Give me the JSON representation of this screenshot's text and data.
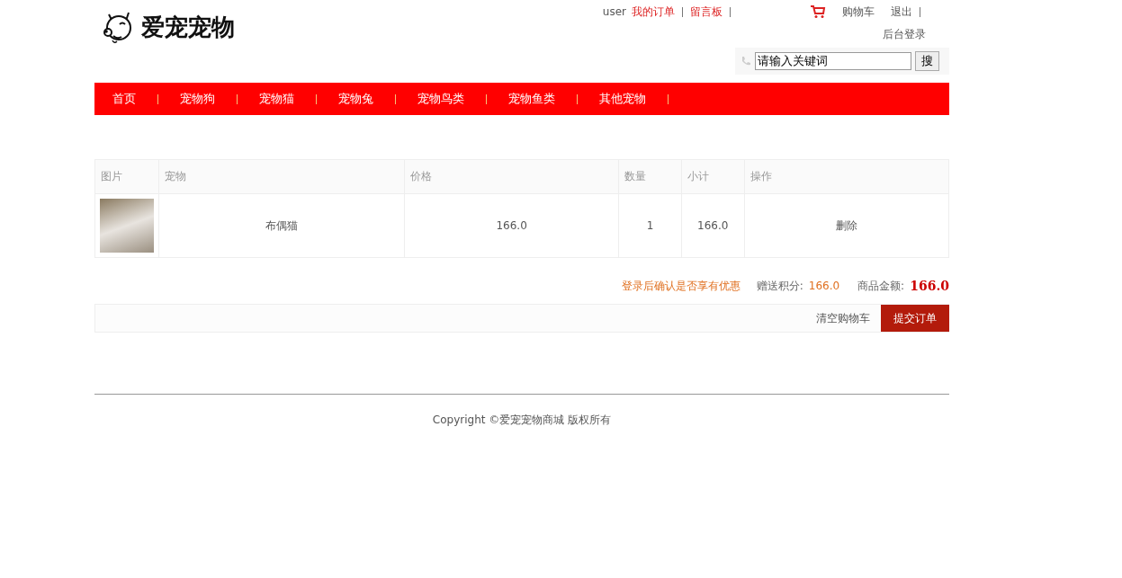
{
  "header": {
    "logo_text": "爱宠宠物",
    "user": "user",
    "links": [
      {
        "label": "我的订单",
        "kind": "accent"
      },
      {
        "label": "留言板",
        "kind": "accent"
      }
    ],
    "cart_label": "购物车",
    "logout": "退出",
    "admin_login": "后台登录",
    "search": {
      "value": "请输入关键词",
      "button": "搜"
    }
  },
  "nav": {
    "items": [
      {
        "label": "首页"
      },
      {
        "label": "宠物狗"
      },
      {
        "label": "宠物猫"
      },
      {
        "label": "宠物兔"
      },
      {
        "label": "宠物鸟类"
      },
      {
        "label": "宠物鱼类"
      },
      {
        "label": "其他宠物"
      }
    ]
  },
  "cart": {
    "columns": [
      "图片",
      "宠物",
      "价格",
      "数量",
      "小计",
      "操作"
    ],
    "rows": [
      {
        "name": "布偶猫",
        "price": "166.0",
        "quantity": "1",
        "subtotal": "166.0",
        "action": "删除"
      }
    ]
  },
  "summary": {
    "notice": "登录后确认是否享有优惠",
    "points_label": "赠送积分:",
    "points": "166.0",
    "total_label": "商品金额:",
    "total": "166.0"
  },
  "actions": {
    "clear": "清空购物车",
    "submit": "提交订单"
  },
  "footer": {
    "copyright": "Copyright ©爱宠宠物商城 版权所有"
  }
}
